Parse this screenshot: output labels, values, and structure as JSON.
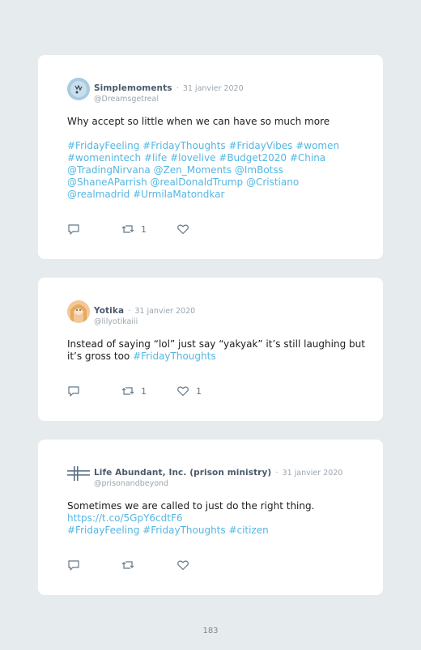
{
  "tweets": [
    {
      "name": "Simplemoments",
      "date": "31 janvier 2020",
      "handle": "@Dreamsgetreal",
      "text": "Why accept so little when we can have so much more",
      "hashtag_lines": [
        "#FridayFeeling #FridayThoughts #FridayVibes #women",
        "#womenintech #life #lovelive #Budget2020 #China",
        "@TradingNirvana @Zen_Moments @ImBotss",
        "@ShaneAParrish @realDonaldTrump @Cristiano",
        "@realmadrid #UrmilaMatondkar"
      ],
      "retweets": "1",
      "likes": "",
      "avatar": "avatar-icon"
    },
    {
      "name": "Yotika",
      "date": "31 janvier 2020",
      "handle": "@lilyotikaiii",
      "text_line1": "Instead of saying “lol” just say “yakyak” it’s still laughing but",
      "text_line2": "it’s gross too",
      "text_line2_tag": "#FridayThoughts",
      "retweets": "1",
      "likes": "1",
      "avatar": "avatar-icon"
    },
    {
      "name": "Life Abundant, Inc. (prison ministry)",
      "date": "31 janvier 2020",
      "handle": "@prisonandbeyond",
      "text": "Sometimes we are called to just do the right thing.",
      "url": "https://t.co/5GpY6cdtF6",
      "hashtags": "#FridayFeeling #FridayThoughts #citizen",
      "retweets": "",
      "likes": "",
      "avatar": "cross-logo-icon"
    }
  ],
  "separator": "·",
  "page_number": "183",
  "colors": {
    "background": "#e6ebee",
    "card": "#ffffff",
    "link": "#55b6e2",
    "name": "#4a5a6a",
    "muted": "#9aa5ae",
    "icon": "#657786"
  }
}
